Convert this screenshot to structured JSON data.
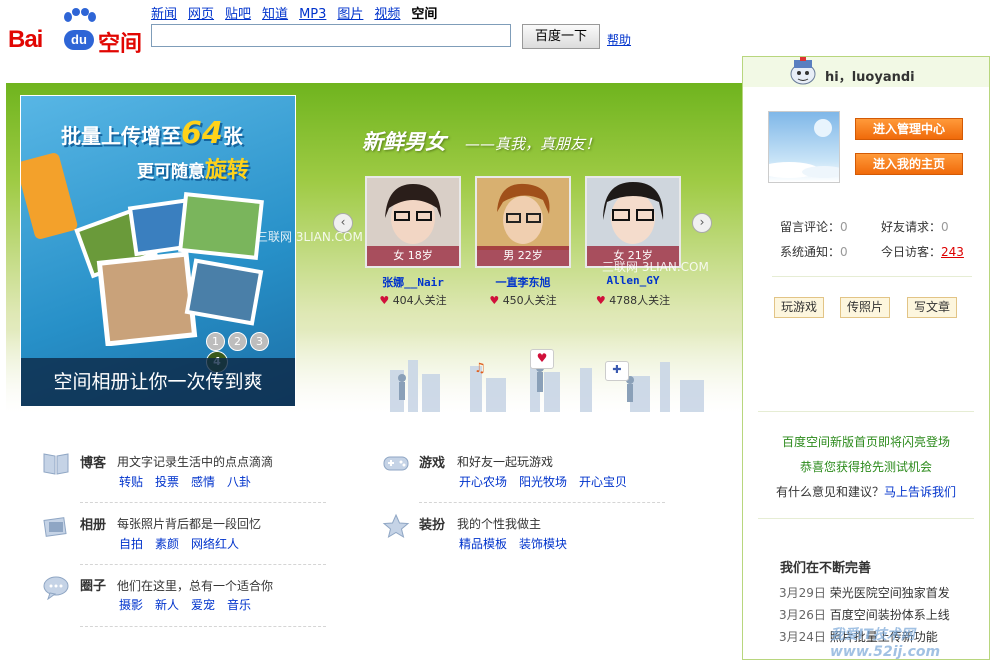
{
  "header": {
    "logo_text": "Bai",
    "logo_du": "du",
    "logo_space": "空间",
    "nav": [
      "新闻",
      "网页",
      "贴吧",
      "知道",
      "MP3",
      "图片",
      "视频",
      "空间"
    ],
    "search_button": "百度一下",
    "help": "帮助"
  },
  "promo": {
    "line1_a": "批量上传增至",
    "line1_num": "64",
    "line1_b": "张",
    "line2_a": "更可随意",
    "line2_b": "旋转",
    "caption": "空间相册让你一次传到爽",
    "pages": [
      "1",
      "2",
      "3",
      "4"
    ]
  },
  "fresh": {
    "title": "新鲜男女",
    "subtitle": "——真我，真朋友！",
    "people": [
      {
        "tag": "女 18岁",
        "name": "张娜__Nair",
        "follow": "404人关注"
      },
      {
        "tag": "男 22岁",
        "name": "一直李东旭",
        "follow": "450人关注"
      },
      {
        "tag": "女 21岁",
        "name": "Allen_GY",
        "follow": "4788人关注"
      }
    ],
    "heart": "♥"
  },
  "watermarks": [
    "三联网 3LIAN.COM",
    "三联网 3LIAN.COM"
  ],
  "categories": [
    {
      "title": "博客",
      "desc": "用文字记录生活中的点点滴滴",
      "links": [
        "转贴",
        "投票",
        "感情",
        "八卦"
      ]
    },
    {
      "title": "相册",
      "desc": "每张照片背后都是一段回忆",
      "links": [
        "自拍",
        "素颜",
        "网络红人"
      ]
    },
    {
      "title": "圈子",
      "desc": "他们在这里，总有一个适合你",
      "links": [
        "摄影",
        "新人",
        "爱宠",
        "音乐"
      ]
    },
    {
      "title": "游戏",
      "desc": "和好友一起玩游戏",
      "links": [
        "开心农场",
        "阳光牧场",
        "开心宝贝"
      ]
    },
    {
      "title": "装扮",
      "desc": "我的个性我做主",
      "links": [
        "精品模板",
        "装饰模块"
      ]
    }
  ],
  "sidebar": {
    "greeting": "hi，luoyandi",
    "manage_btn": "进入管理中心",
    "home_btn": "进入我的主页",
    "stats": [
      {
        "label": "留言评论：",
        "value": "0"
      },
      {
        "label": "好友请求：",
        "value": "0"
      },
      {
        "label": "系统通知：",
        "value": "0"
      },
      {
        "label": "今日访客：",
        "value": "243"
      }
    ],
    "actions": [
      "玩游戏",
      "传照片",
      "写文章"
    ],
    "notice1": "百度空间新版首页即将闪亮登场",
    "notice2": "恭喜您获得抢先测试机会",
    "feedback_q": "有什么意见和建议？",
    "feedback_link": "马上告诉我们",
    "news_title": "我们在不断完善",
    "news": [
      {
        "date": "3月29日",
        "text": "荣光医院空间独家首发"
      },
      {
        "date": "3月26日",
        "text": "百度空间装扮体系上线"
      },
      {
        "date": "3月24日",
        "text": "照片批量上传新功能"
      }
    ]
  },
  "corner_watermark": "我爱IT技术网 www.52ij.com"
}
